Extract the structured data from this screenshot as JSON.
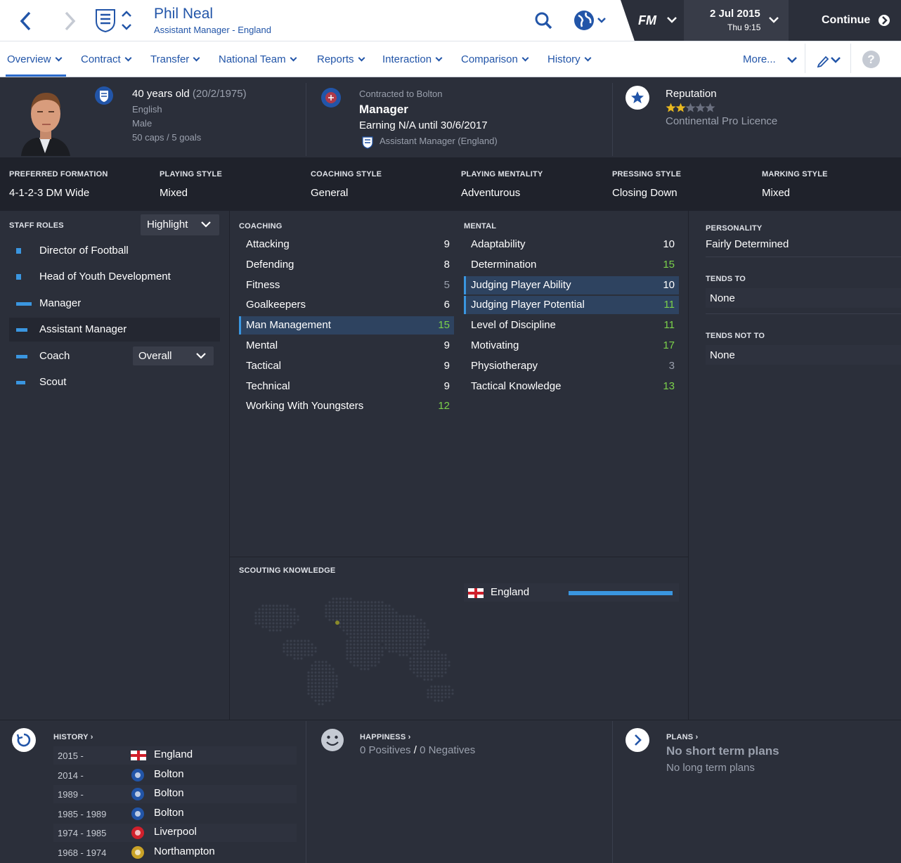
{
  "header": {
    "person_name": "Phil Neal",
    "person_subtitle": "Assistant Manager - England",
    "fm_logo": "FM",
    "date": "2 Jul 2015",
    "day_time": "Thu 9:15",
    "continue_label": "Continue"
  },
  "tabs": [
    {
      "label": "Overview"
    },
    {
      "label": "Contract"
    },
    {
      "label": "Transfer"
    },
    {
      "label": "National Team"
    },
    {
      "label": "Reports"
    },
    {
      "label": "Interaction"
    },
    {
      "label": "Comparison"
    },
    {
      "label": "History"
    }
  ],
  "more_label": "More...",
  "profile": {
    "age": "40 years old",
    "dob": "(20/2/1975)",
    "nationality": "English",
    "gender": "Male",
    "caps": "50 caps / 5 goals",
    "contract_line": "Contracted to Bolton",
    "role": "Manager",
    "earning": "Earning N/A until 30/6/2017",
    "second_job": "Assistant Manager (England)",
    "reputation_label": "Reputation",
    "reputation_stars": 2,
    "reputation_max": 5,
    "licence": "Continental Pro Licence"
  },
  "tactics": [
    {
      "label": "PREFERRED FORMATION",
      "value": "4-1-2-3 DM Wide"
    },
    {
      "label": "PLAYING STYLE",
      "value": "Mixed"
    },
    {
      "label": "COACHING STYLE",
      "value": "General"
    },
    {
      "label": "PLAYING MENTALITY",
      "value": "Adventurous"
    },
    {
      "label": "PRESSING STYLE",
      "value": "Closing Down"
    },
    {
      "label": "MARKING STYLE",
      "value": "Mixed"
    }
  ],
  "staff_roles": {
    "title": "STAFF ROLES",
    "highlight": "Highlight",
    "coach_dropdown": "Overall",
    "items": [
      {
        "label": "Director of Football",
        "level": 0.25
      },
      {
        "label": "Head of Youth Development",
        "level": 0.25
      },
      {
        "label": "Manager",
        "level": 0.85
      },
      {
        "label": "Assistant Manager",
        "level": 0.6
      },
      {
        "label": "Coach",
        "level": 0.6
      },
      {
        "label": "Scout",
        "level": 0.5
      }
    ]
  },
  "coaching": {
    "title": "COACHING",
    "items": [
      {
        "name": "Attacking",
        "value": "9"
      },
      {
        "name": "Defending",
        "value": "8"
      },
      {
        "name": "Fitness",
        "value": "5"
      },
      {
        "name": "Goalkeepers",
        "value": "6"
      },
      {
        "name": "Man Management",
        "value": "15"
      },
      {
        "name": "Mental",
        "value": "9"
      },
      {
        "name": "Tactical",
        "value": "9"
      },
      {
        "name": "Technical",
        "value": "9"
      },
      {
        "name": "Working With Youngsters",
        "value": "12"
      }
    ]
  },
  "mental": {
    "title": "MENTAL",
    "items": [
      {
        "name": "Adaptability",
        "value": "10"
      },
      {
        "name": "Determination",
        "value": "15"
      },
      {
        "name": "Judging Player Ability",
        "value": "10"
      },
      {
        "name": "Judging Player Potential",
        "value": "11"
      },
      {
        "name": "Level of Discipline",
        "value": "11"
      },
      {
        "name": "Motivating",
        "value": "17"
      },
      {
        "name": "Physiotherapy",
        "value": "3"
      },
      {
        "name": "Tactical Knowledge",
        "value": "13"
      }
    ]
  },
  "personality": {
    "title": "PERSONALITY",
    "value": "Fairly Determined",
    "tends_to_title": "TENDS TO",
    "tends_to": "None",
    "tends_not_to_title": "TENDS NOT TO",
    "tends_not_to": "None"
  },
  "scouting": {
    "title": "SCOUTING KNOWLEDGE",
    "country": "England",
    "knowledge_level": 1.0
  },
  "history": {
    "title": "HISTORY",
    "rows": [
      {
        "years": "2015 -",
        "club": "England"
      },
      {
        "years": "2014 -",
        "club": "Bolton"
      },
      {
        "years": "1989 -",
        "club": "Bolton"
      },
      {
        "years": "1985 - 1989",
        "club": "Bolton"
      },
      {
        "years": "1974 - 1985",
        "club": "Liverpool"
      },
      {
        "years": "1968 - 1974",
        "club": "Northampton"
      }
    ]
  },
  "happiness": {
    "title": "HAPPINESS",
    "positives": "0 Positives",
    "separator": "/",
    "negatives": "0 Negatives"
  },
  "plans": {
    "title": "PLANS",
    "short": "No short term plans",
    "long": "No long term plans"
  },
  "colors": {
    "accent": "#2255a8",
    "bar": "#3a96e0",
    "good": "#7bd14a",
    "panel": "#2b2f3a",
    "dark": "#1f222b"
  }
}
